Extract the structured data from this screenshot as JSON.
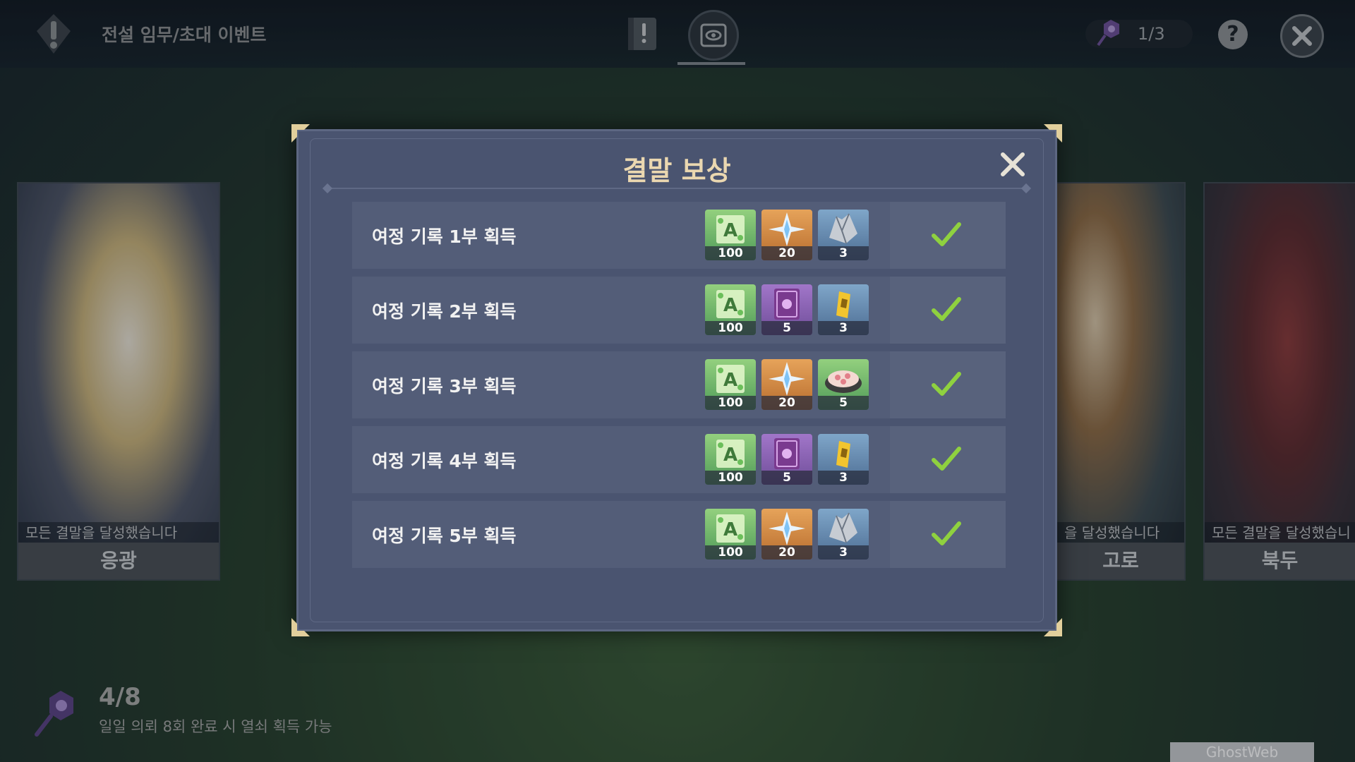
{
  "topbar": {
    "title": "전설 임무/초대 이벤트",
    "key_counter": "1/3",
    "help_label": "?",
    "icons": [
      "exclamation-event-icon",
      "book-tab-icon",
      "gallery-tab-icon",
      "key-icon",
      "help-icon",
      "close-icon"
    ]
  },
  "characters": [
    {
      "name": "응광",
      "status": "모든 결말을 달성했습니다"
    },
    {
      "name": "고로",
      "status": "을 달성했습니다"
    },
    {
      "name": "북두",
      "status": "모든 결말을 달성했습니"
    }
  ],
  "modal": {
    "title": "결말 보상",
    "rows": [
      {
        "label": "여정 기록 1부 획득",
        "items": [
          {
            "icon": "adventure-exp-icon",
            "qty": "100"
          },
          {
            "icon": "primogem-icon",
            "qty": "20"
          },
          {
            "icon": "mystic-ore-icon",
            "qty": "3"
          }
        ],
        "claimed": true
      },
      {
        "label": "여정 기록 2부 획득",
        "items": [
          {
            "icon": "adventure-exp-icon",
            "qty": "100"
          },
          {
            "icon": "heros-wit-icon",
            "qty": "5"
          },
          {
            "icon": "crystal-chunk-icon",
            "qty": "3"
          }
        ],
        "claimed": true
      },
      {
        "label": "여정 기록 3부 획득",
        "items": [
          {
            "icon": "adventure-exp-icon",
            "qty": "100"
          },
          {
            "icon": "primogem-icon",
            "qty": "20"
          },
          {
            "icon": "food-dish-icon",
            "qty": "5"
          }
        ],
        "claimed": true
      },
      {
        "label": "여정 기록 4부 획득",
        "items": [
          {
            "icon": "adventure-exp-icon",
            "qty": "100"
          },
          {
            "icon": "heros-wit-icon",
            "qty": "5"
          },
          {
            "icon": "crystal-chunk-icon",
            "qty": "3"
          }
        ],
        "claimed": true
      },
      {
        "label": "여정 기록 5부 획득",
        "items": [
          {
            "icon": "adventure-exp-icon",
            "qty": "100"
          },
          {
            "icon": "primogem-icon",
            "qty": "20"
          },
          {
            "icon": "mystic-ore-icon",
            "qty": "3"
          }
        ],
        "claimed": true
      }
    ]
  },
  "footer": {
    "key_count": "4/8",
    "key_desc": "일일 의뢰 8회 완료 시 열쇠 획득 가능",
    "watermark": "GhostWeb"
  },
  "colors": {
    "modal_bg": "#4a5470",
    "title_gold": "#ead7b0",
    "check_green": "#8fd13f"
  }
}
